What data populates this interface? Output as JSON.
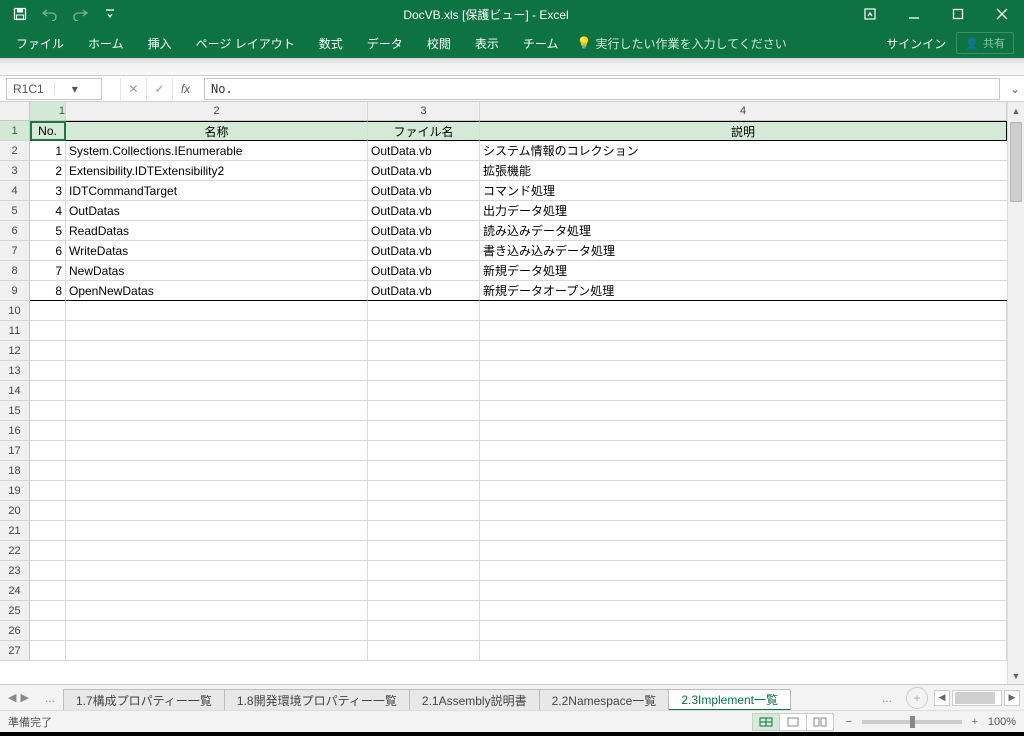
{
  "titlebar": {
    "title": "DocVB.xls  [保護ビュー] - Excel"
  },
  "ribbon": {
    "tabs": [
      "ファイル",
      "ホーム",
      "挿入",
      "ページ レイアウト",
      "数式",
      "データ",
      "校閲",
      "表示",
      "チーム"
    ],
    "tell_me": "実行したい作業を入力してください",
    "sign_in": "サインイン",
    "share": "共有"
  },
  "formula_bar": {
    "name_box": "R1C1",
    "formula": "No."
  },
  "columns": {
    "headers": [
      "1",
      "2",
      "3",
      "4"
    ],
    "titles": {
      "c1": "No.",
      "c2": "名称",
      "c3": "ファイル名",
      "c4": "説明"
    }
  },
  "rows": [
    {
      "no": "1",
      "name": "System.Collections.IEnumerable",
      "file": "OutData.vb",
      "desc": "システム情報のコレクション"
    },
    {
      "no": "2",
      "name": "Extensibility.IDTExtensibility2",
      "file": "OutData.vb",
      "desc": "拡張機能"
    },
    {
      "no": "3",
      "name": "IDTCommandTarget",
      "file": "OutData.vb",
      "desc": "コマンド処理"
    },
    {
      "no": "4",
      "name": "OutDatas",
      "file": "OutData.vb",
      "desc": "出力データ処理"
    },
    {
      "no": "5",
      "name": "ReadDatas",
      "file": "OutData.vb",
      "desc": "読み込みデータ処理"
    },
    {
      "no": "6",
      "name": "WriteDatas",
      "file": "OutData.vb",
      "desc": "書き込み込みデータ処理"
    },
    {
      "no": "7",
      "name": "NewDatas",
      "file": "OutData.vb",
      "desc": "新規データ処理"
    },
    {
      "no": "8",
      "name": "OpenNewDatas",
      "file": "OutData.vb",
      "desc": "新規データオープン処理"
    }
  ],
  "row_headers_total": 27,
  "sheets": {
    "visible": [
      "1.7構成プロパティー一覧",
      "1.8開発環境プロパティー一覧",
      "2.1Assembly説明書",
      "2.2Namespace一覧",
      "2.3Implement一覧"
    ],
    "active": "2.3Implement一覧"
  },
  "status": {
    "left": "準備完了",
    "zoom": "100%"
  }
}
